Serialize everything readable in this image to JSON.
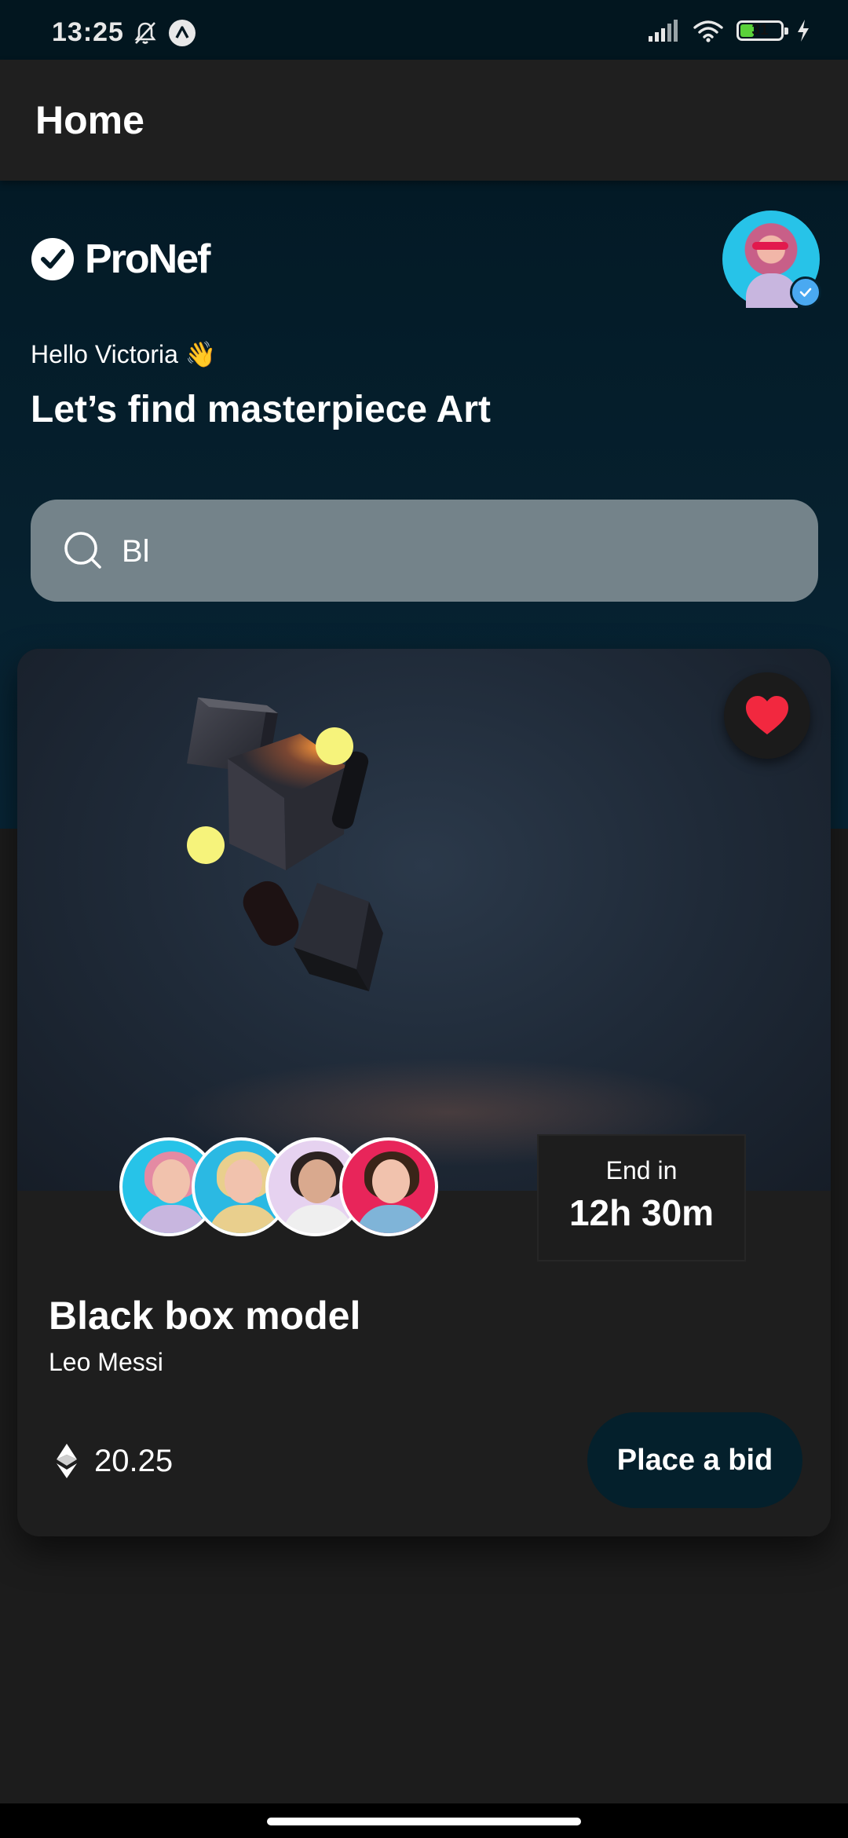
{
  "status_bar": {
    "time": "13:25",
    "battery": "31",
    "battery_level": 0.31,
    "left_icons": [
      "bell-off-icon",
      "nav-circle-icon"
    ],
    "right_icons": [
      "signal-icon",
      "wifi-icon",
      "battery-icon",
      "charging-bolt-icon"
    ]
  },
  "app_bar": {
    "title": "Home"
  },
  "header": {
    "logo_text": "ProNef",
    "logo_icon": "check-circle-icon",
    "greeting": "Hello Victoria 👋",
    "headline": "Let’s find masterpiece Art"
  },
  "search": {
    "value": "Bl",
    "icon": "search-icon"
  },
  "card": {
    "title": "Black box model",
    "artist": "Leo Messi",
    "end_label": "End in",
    "end_value": "12h 30m",
    "price": "20.25",
    "price_icon": "ethereum-icon",
    "bid_button": "Place a bid",
    "favorite_icon": "heart-icon",
    "bidder_icons": [
      "bidder-avatar-1",
      "bidder-avatar-2",
      "bidder-avatar-3",
      "bidder-avatar-4"
    ]
  },
  "colors": {
    "hero_bg": "#031a26",
    "search_bg": "#74838a",
    "card_bg": "#1e1e1e",
    "bid_button_bg": "#04202c",
    "heart": "#f2283f",
    "accent_dots": "#f6f37b"
  }
}
